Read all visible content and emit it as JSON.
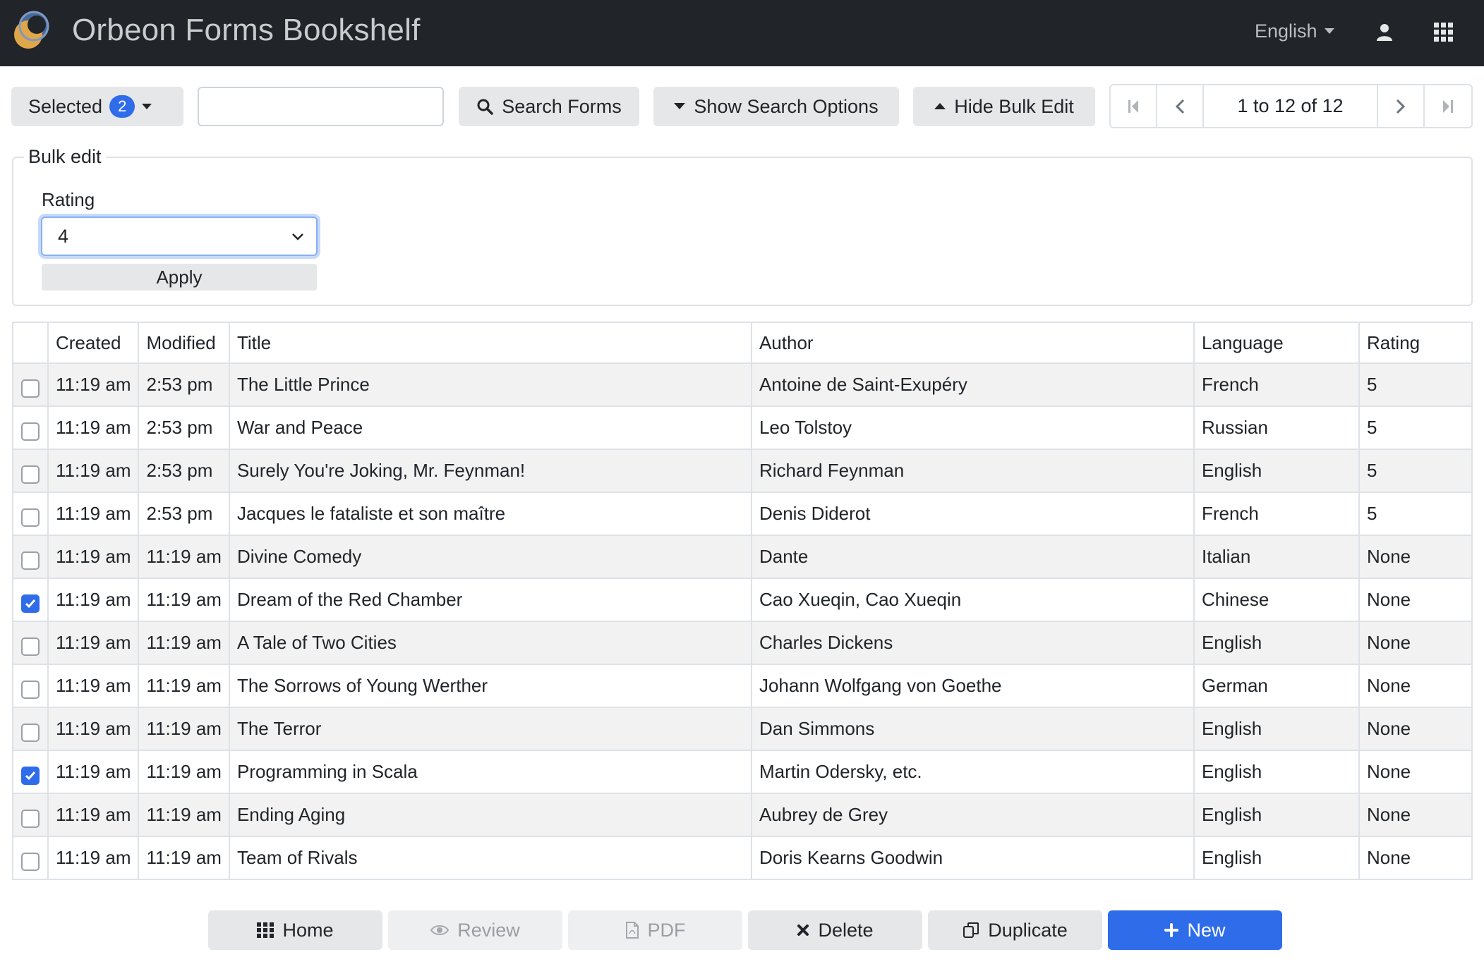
{
  "header": {
    "title": "Orbeon Forms Bookshelf",
    "language": "English",
    "logo_icon": "orbeon-logo",
    "user_icon": "user-icon",
    "apps_icon": "apps-grid-icon"
  },
  "toolbar": {
    "selected_label": "Selected",
    "selected_count": "2",
    "search_value": "",
    "search_button": "Search Forms",
    "search_options_button": "Show Search Options",
    "bulk_edit_button": "Hide Bulk Edit",
    "pager_text": "1 to 12 of 12"
  },
  "bulk_edit": {
    "legend": "Bulk edit",
    "rating_label": "Rating",
    "rating_value": "4",
    "apply_button": "Apply"
  },
  "table": {
    "columns": [
      "Created",
      "Modified",
      "Title",
      "Author",
      "Language",
      "Rating"
    ],
    "rows": [
      {
        "checked": false,
        "created": "11:19 am",
        "modified": "2:53 pm",
        "title": "The Little Prince",
        "author": "Antoine de Saint-Exupéry",
        "language": "French",
        "rating": "5"
      },
      {
        "checked": false,
        "created": "11:19 am",
        "modified": "2:53 pm",
        "title": "War and Peace",
        "author": "Leo Tolstoy",
        "language": "Russian",
        "rating": "5"
      },
      {
        "checked": false,
        "created": "11:19 am",
        "modified": "2:53 pm",
        "title": "Surely You're Joking, Mr. Feynman!",
        "author": "Richard Feynman",
        "language": "English",
        "rating": "5"
      },
      {
        "checked": false,
        "created": "11:19 am",
        "modified": "2:53 pm",
        "title": "Jacques le fataliste et son maître",
        "author": "Denis Diderot",
        "language": "French",
        "rating": "5"
      },
      {
        "checked": false,
        "created": "11:19 am",
        "modified": "11:19 am",
        "title": "Divine Comedy",
        "author": "Dante",
        "language": "Italian",
        "rating": "None"
      },
      {
        "checked": true,
        "created": "11:19 am",
        "modified": "11:19 am",
        "title": "Dream of the Red Chamber",
        "author": "Cao Xueqin, Cao Xueqin",
        "language": "Chinese",
        "rating": "None"
      },
      {
        "checked": false,
        "created": "11:19 am",
        "modified": "11:19 am",
        "title": "A Tale of Two Cities",
        "author": "Charles Dickens",
        "language": "English",
        "rating": "None"
      },
      {
        "checked": false,
        "created": "11:19 am",
        "modified": "11:19 am",
        "title": "The Sorrows of Young Werther",
        "author": "Johann Wolfgang von Goethe",
        "language": "German",
        "rating": "None"
      },
      {
        "checked": false,
        "created": "11:19 am",
        "modified": "11:19 am",
        "title": "The Terror",
        "author": "Dan Simmons",
        "language": "English",
        "rating": "None"
      },
      {
        "checked": true,
        "created": "11:19 am",
        "modified": "11:19 am",
        "title": "Programming in Scala",
        "author": "Martin Odersky, etc.",
        "language": "English",
        "rating": "None"
      },
      {
        "checked": false,
        "created": "11:19 am",
        "modified": "11:19 am",
        "title": "Ending Aging",
        "author": "Aubrey de Grey",
        "language": "English",
        "rating": "None"
      },
      {
        "checked": false,
        "created": "11:19 am",
        "modified": "11:19 am",
        "title": "Team of Rivals",
        "author": "Doris Kearns Goodwin",
        "language": "English",
        "rating": "None"
      }
    ]
  },
  "bottom_buttons": {
    "home": "Home",
    "review": "Review",
    "pdf": "PDF",
    "delete": "Delete",
    "duplicate": "Duplicate",
    "new": "New"
  },
  "colors": {
    "navbar": "#212529",
    "primary": "#2f6cea",
    "button_grey": "#e6e7e9",
    "stripe": "#f2f2f2"
  }
}
